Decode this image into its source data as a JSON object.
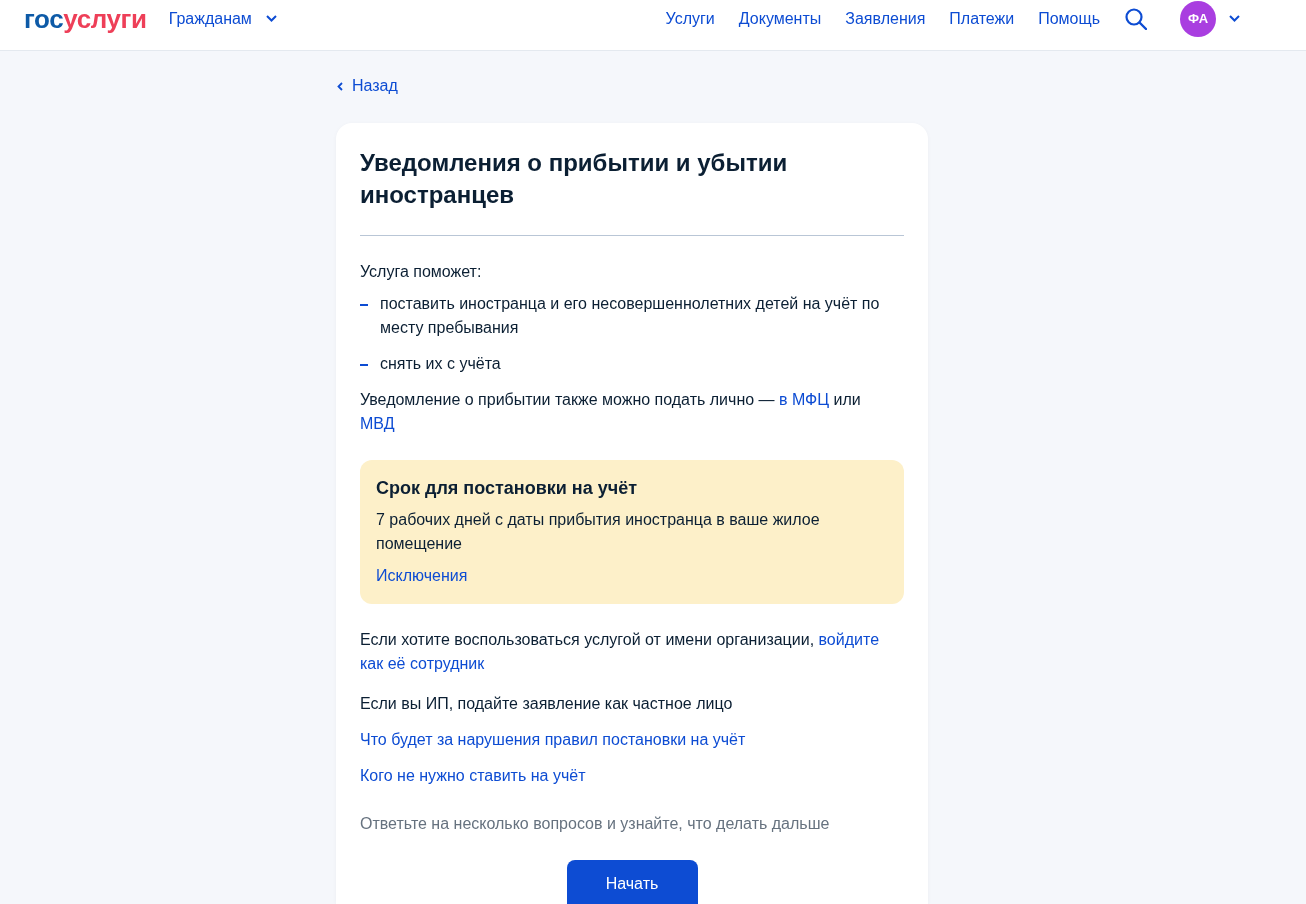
{
  "header": {
    "logo": {
      "parts": [
        "гос",
        "услуги"
      ]
    },
    "audience_menu": {
      "label": "Гражданам"
    },
    "nav": [
      "Услуги",
      "Документы",
      "Заявления",
      "Платежи",
      "Помощь"
    ],
    "avatar": {
      "initials": "ФА"
    }
  },
  "back_link": "Назад",
  "card": {
    "title": "Уведомления о прибытии и убытии иностранцев",
    "intro": "Услуга поможет:",
    "benefits": [
      "поставить иностранца и его несовершеннолетних детей на учёт по месту пребывания",
      "снять их с учёта"
    ],
    "in_person_note": [
      {
        "kind": "text",
        "text": "Уведомление о прибытии также можно подать лично — "
      },
      {
        "kind": "link",
        "text": "в МФЦ"
      },
      {
        "kind": "text",
        "text": " или "
      },
      {
        "kind": "link",
        "text": "МВД"
      }
    ],
    "deadline_notice": {
      "title": "Срок для постановки на учёт",
      "text": "7 рабочих дней с даты прибытия иностранца в ваше жилое помещение",
      "link": "Исключения"
    },
    "organization_note": [
      {
        "kind": "text",
        "text": "Если хотите воспользоваться услугой от имени организации, "
      },
      {
        "kind": "link",
        "text": "войдите"
      },
      {
        "kind": "link",
        "text": "как её сотрудник"
      }
    ],
    "entrepreneur_note": "Если вы ИП, подайте заявление как частное лицо",
    "links": [
      "Что будет за нарушения правил постановки на учёт",
      "Кого не нужно ставить на учёт"
    ],
    "hint": "Ответьте на несколько вопросов и узнайте, что делать дальше",
    "start_button": "Начать"
  }
}
